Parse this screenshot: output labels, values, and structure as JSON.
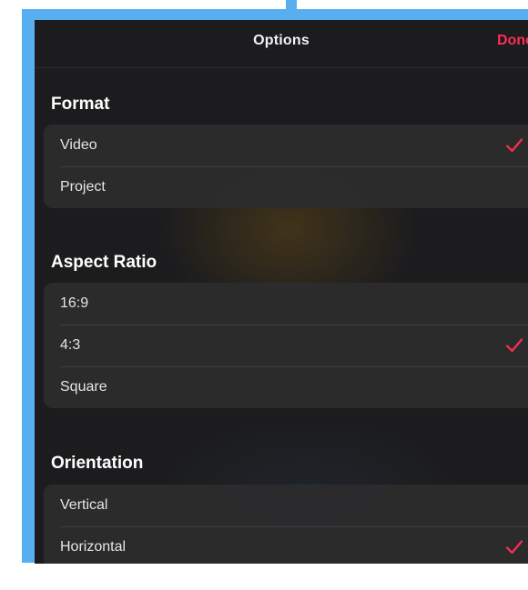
{
  "navbar": {
    "title": "Options",
    "done_label": "Done"
  },
  "accent_color": "#ff2d55",
  "sections": [
    {
      "title": "Format",
      "rows": [
        {
          "label": "Video",
          "selected": true
        },
        {
          "label": "Project",
          "selected": false
        }
      ]
    },
    {
      "title": "Aspect Ratio",
      "rows": [
        {
          "label": "16:9",
          "selected": false
        },
        {
          "label": "4:3",
          "selected": true
        },
        {
          "label": "Square",
          "selected": false
        }
      ]
    },
    {
      "title": "Orientation",
      "rows": [
        {
          "label": "Vertical",
          "selected": false
        },
        {
          "label": "Horizontal",
          "selected": true
        }
      ]
    }
  ],
  "icons": {
    "selected_marker": "checkmark-icon"
  }
}
